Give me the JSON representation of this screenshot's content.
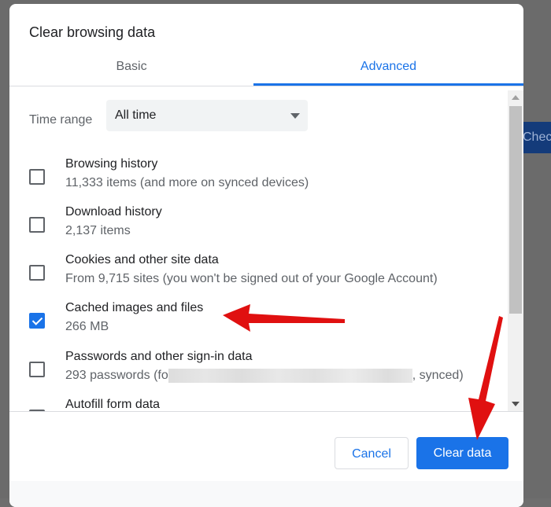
{
  "dialog": {
    "title": "Clear browsing data",
    "tabs": [
      {
        "label": "Basic"
      },
      {
        "label": "Advanced"
      }
    ],
    "time_range": {
      "label": "Time range",
      "value": "All time"
    },
    "items": [
      {
        "label": "Browsing history",
        "sub": "11,333 items (and more on synced devices)",
        "checked": false
      },
      {
        "label": "Download history",
        "sub": "2,137 items",
        "checked": false
      },
      {
        "label": "Cookies and other site data",
        "sub": "From 9,715 sites (you won't be signed out of your Google Account)",
        "checked": false
      },
      {
        "label": "Cached images and files",
        "sub": "266 MB",
        "checked": true
      },
      {
        "label": "Passwords and other sign-in data",
        "sub_prefix": "293 passwords (fo",
        "sub_suffix": ", synced)",
        "checked": false
      },
      {
        "label": "Autofill form data",
        "checked": false
      }
    ],
    "cancel": "Cancel",
    "clear": "Clear data"
  },
  "background": {
    "button": "Chec"
  },
  "colors": {
    "accent": "#1a73e8",
    "arrow": "#e01010"
  }
}
